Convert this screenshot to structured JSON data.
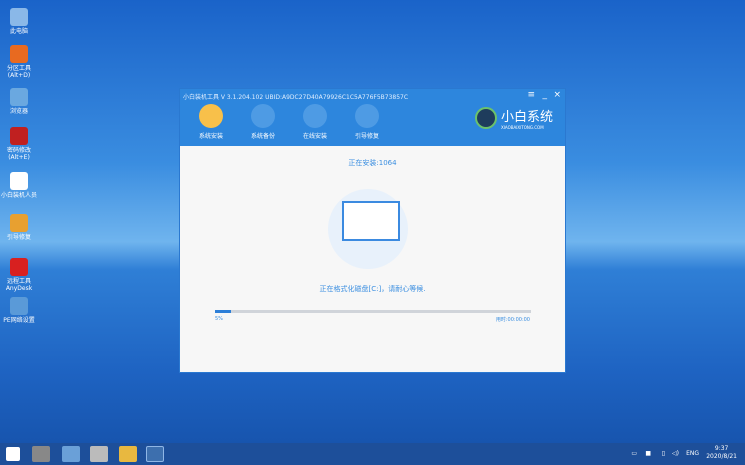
{
  "desktop": [
    {
      "label": "此电脑"
    },
    {
      "label": "分区工具(Alt+D)"
    },
    {
      "label": "浏览器"
    },
    {
      "label": "密码修改(Alt+E)"
    },
    {
      "label": "小白装机人员"
    },
    {
      "label": "引导修复"
    },
    {
      "label": "远程工具AnyDesk"
    },
    {
      "label": "PE网络设置"
    }
  ],
  "window": {
    "title": "小白装机工具 V 3.1.204.102 UBID:A9DC27D40A79926C1C5A776F5B73857C",
    "tabs": [
      {
        "label": "系统安装"
      },
      {
        "label": "系统备份"
      },
      {
        "label": "在线安装"
      },
      {
        "label": "引导修复"
      }
    ],
    "logo": {
      "name": "小白系统",
      "url_text": "XIAOBAIXITONG.COM"
    },
    "status": "正在安装:1064",
    "message": "正在格式化磁盘[C:]，请耐心等候.",
    "progress": {
      "percent": 5,
      "label": "5%",
      "elapsed": "用时:00:00:00"
    }
  },
  "taskbar": {
    "lang": "ENG",
    "time": "9:37",
    "date": "2020/8/21"
  },
  "colors": {
    "accent": "#2d86dd",
    "active_tab": "#f8c04a"
  }
}
